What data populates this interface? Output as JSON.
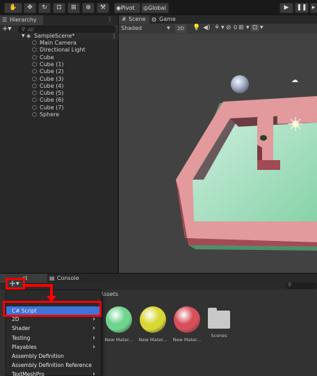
{
  "toolbar": {
    "pivot": "Pivot",
    "global": "Global"
  },
  "hierarchy": {
    "tab": "Hierarchy",
    "search_placeholder": "All",
    "scene": "SampleScene*",
    "items": [
      "Main Camera",
      "Directional Light",
      "Cube",
      "Cube (1)",
      "Cube (2)",
      "Cube (3)",
      "Cube (4)",
      "Cube (5)",
      "Cube (6)",
      "Cube (7)",
      "Sphere"
    ]
  },
  "scene_view": {
    "tab_scene": "Scene",
    "tab_game": "Game",
    "shading": "Shaded",
    "mode_2d": "2D",
    "gizmo_count": "0"
  },
  "project": {
    "tab_project": "ct",
    "tab_console": "Console",
    "assets_label": "Assets",
    "add_label": "+"
  },
  "menu": {
    "items": [
      {
        "label": "C# Script",
        "submenu": false,
        "selected": true
      },
      {
        "label": "2D",
        "submenu": true
      },
      {
        "label": "Shader",
        "submenu": true
      },
      {
        "label": "Testing",
        "submenu": true
      },
      {
        "label": "Playables",
        "submenu": true
      },
      {
        "label": "Assembly Definition",
        "submenu": false
      },
      {
        "label": "Assembly Definition Reference",
        "submenu": false
      },
      {
        "label": "TextMeshPro",
        "submenu": true
      }
    ]
  },
  "assets": [
    {
      "label": "New Mater...",
      "color": "#6fd48e"
    },
    {
      "label": "New Mater...",
      "color": "#d8d834"
    },
    {
      "label": "New Mater...",
      "color": "#d84f5a"
    },
    {
      "label": "Scenes",
      "color": "#c9c9c9"
    }
  ],
  "colors": {
    "highlight": "#ff0000",
    "selection": "#3f73d8"
  }
}
